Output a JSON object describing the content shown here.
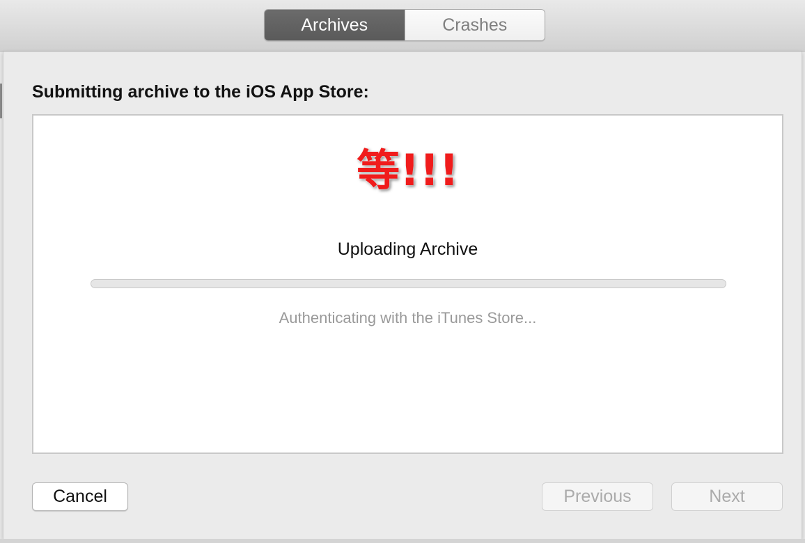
{
  "toolbar": {
    "tabs": [
      {
        "label": "Archives",
        "active": true
      },
      {
        "label": "Crashes",
        "active": false
      }
    ]
  },
  "sheet": {
    "heading": "Submitting archive to the iOS App Store:",
    "overlay_text": "等!!!",
    "status_title": "Uploading Archive",
    "progress_fraction": 0,
    "status_subtitle": "Authenticating with the iTunes Store..."
  },
  "buttons": {
    "cancel": "Cancel",
    "previous": "Previous",
    "next": "Next"
  },
  "colors": {
    "overlay_red": "#f01c1c",
    "active_tab": "#5f5f5f",
    "muted_text": "#9a9a9a"
  }
}
